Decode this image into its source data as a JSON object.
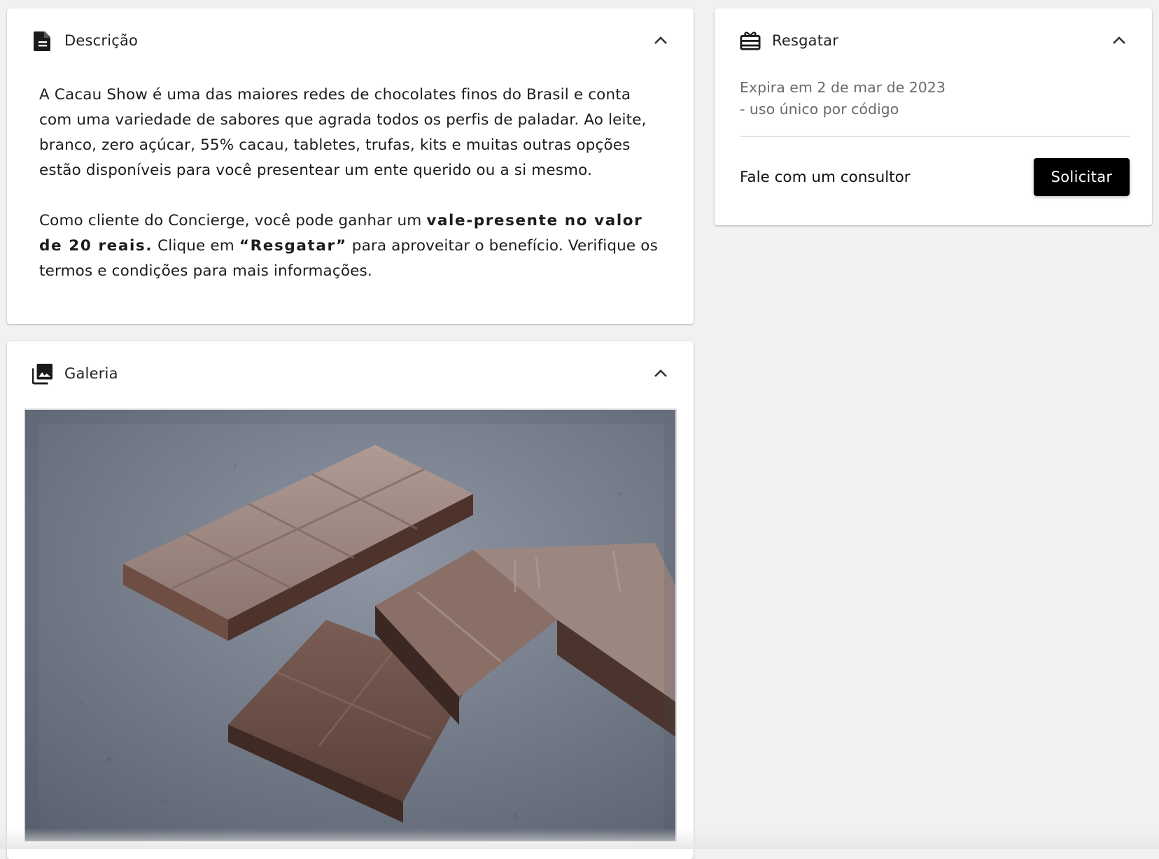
{
  "description": {
    "title": "Descrição",
    "icon": "document-icon",
    "paragraph1": "A Cacau Show é uma das maiores redes de chocolates finos do Brasil e conta com uma variedade de sabores que agrada todos os perfis de paladar. Ao leite, branco, zero açúcar, 55% cacau, tabletes, trufas, kits e muitas outras opções estão disponíveis para você presentear um ente querido ou a si mesmo.",
    "paragraph2_part1": "Como cliente do Concierge, você pode ganhar um ",
    "paragraph2_bold1": "vale-presente no valor de 20 reais.",
    "paragraph2_part2": " Clique em ",
    "paragraph2_bold2": "“Resgatar”",
    "paragraph2_part3": " para aproveitar o benefício. Verifique os termos e condições para mais informações."
  },
  "gallery": {
    "title": "Galeria",
    "icon": "photo-library-icon",
    "image_subject": "chocolate bars on grey surface"
  },
  "redeem": {
    "title": "Resgatar",
    "icon": "gift-card-icon",
    "expiry_line1": "Expira em 2 de mar de 2023",
    "expiry_line2": "- uso único por código",
    "consultant_label": "Fale com um consultor",
    "request_button": "Solicitar"
  },
  "colors": {
    "page_bg": "#f1f1f1",
    "card_bg": "#ffffff",
    "button_bg": "#000000",
    "button_text": "#ffffff",
    "muted_text": "#6a6a6a"
  }
}
